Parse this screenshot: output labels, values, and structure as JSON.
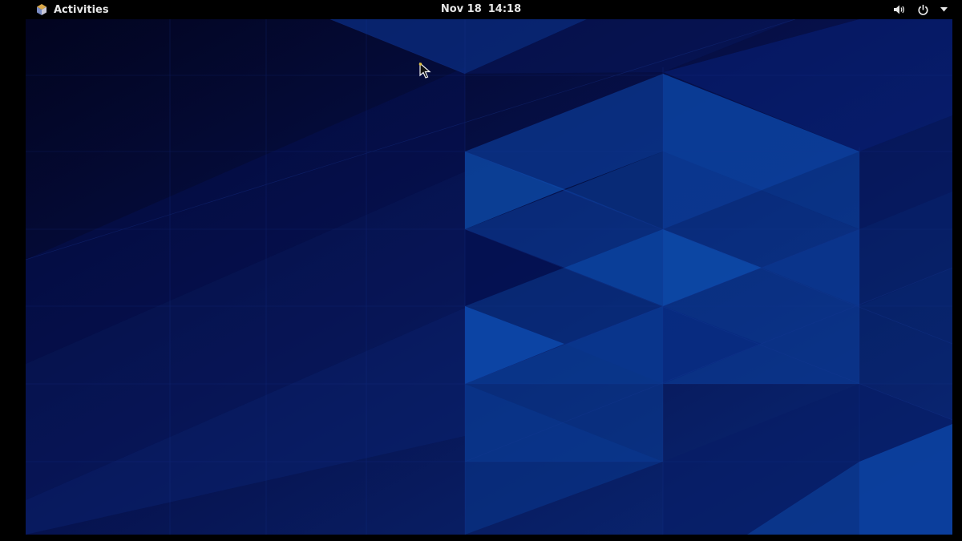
{
  "top_bar": {
    "activities_label": "Activities",
    "activities_icon": "activities-icon",
    "clock_date": "Nov 18",
    "clock_time": "14:18",
    "status_icons": [
      "volume-icon",
      "power-icon",
      "dropdown-arrow-icon"
    ]
  },
  "desktop": {
    "wallpaper": "blue-geometric-triangles",
    "colors": {
      "panel": "#000000",
      "panel_text": "#e6e6e6",
      "wallpaper_dark": "#03062a",
      "wallpaper_mid": "#0a2068",
      "wallpaper_light": "#0b46a0"
    }
  }
}
